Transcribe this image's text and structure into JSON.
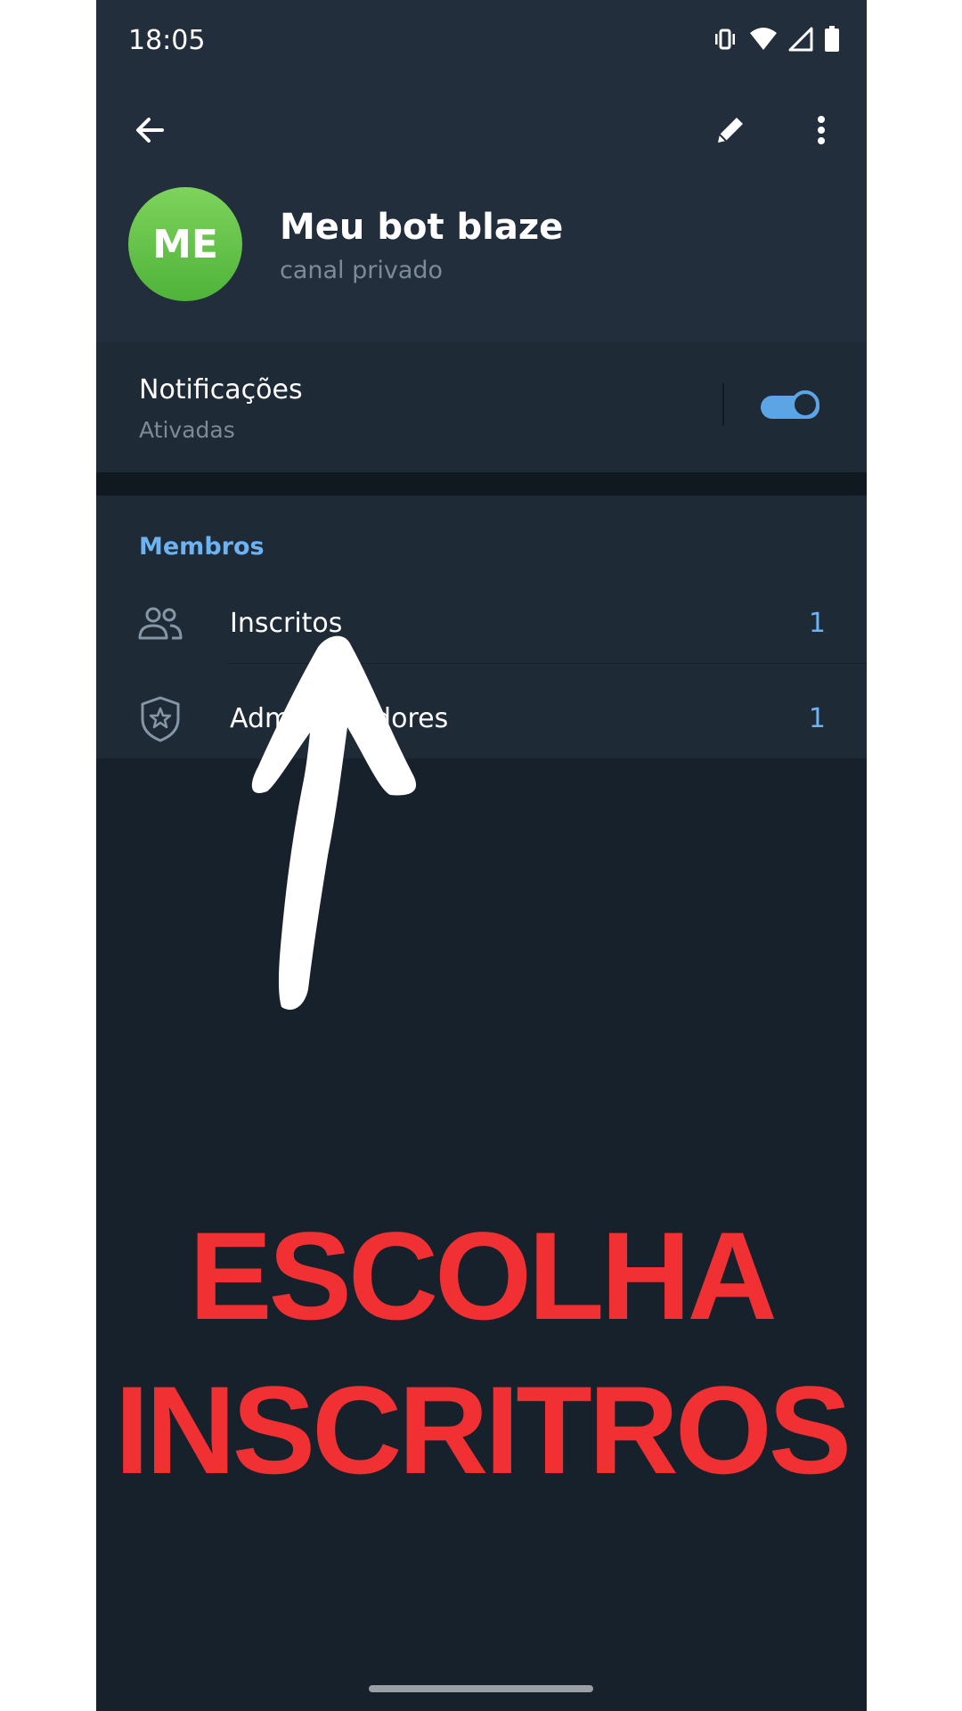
{
  "status_bar": {
    "time": "18:05",
    "icons": [
      "vibrate-icon",
      "wifi-icon",
      "signal-icon",
      "battery-icon"
    ]
  },
  "header": {
    "actions": [
      "back-arrow-icon",
      "pencil-icon",
      "more-vert-icon"
    ],
    "avatar_initials": "ME",
    "avatar_color": "#5fc146",
    "channel_name": "Meu bot blaze",
    "channel_subtitle": "canal privado"
  },
  "notifications": {
    "title": "Notificações",
    "status": "Ativadas",
    "enabled": true
  },
  "members": {
    "section_title": "Membros",
    "rows": [
      {
        "icon": "people-icon",
        "label": "Inscritos",
        "count": "1"
      },
      {
        "icon": "shield-star-icon",
        "label": "Administradores",
        "count": "1"
      }
    ]
  },
  "overlay": {
    "line1": "ESCOLHA",
    "line2": "INSCRITROS",
    "color": "#f03033",
    "arrow": "hand-drawn-arrow-up"
  },
  "colors": {
    "header_bg": "#222e3b",
    "section_bg": "#1e2a36",
    "page_bg": "#17212b",
    "accent": "#6db3f2"
  }
}
